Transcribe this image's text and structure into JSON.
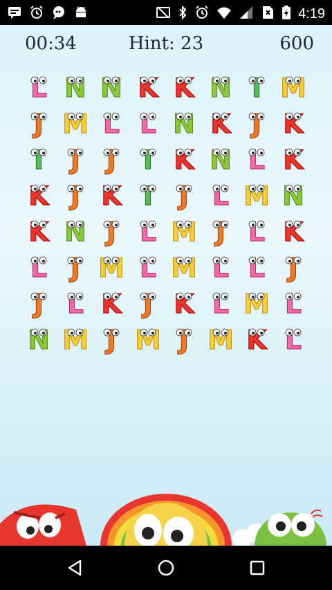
{
  "status_bar": {
    "time": "4:19",
    "left_icons": [
      "message-icon",
      "alarm-icon",
      "chat-icon",
      "android-icon"
    ],
    "right_icons": [
      "cast-off-icon",
      "bluetooth-icon",
      "alarm-icon",
      "wifi-icon",
      "signal-icon",
      "no-sim-icon",
      "battery-icon"
    ]
  },
  "hud": {
    "timer": "00:34",
    "hint": "Hint: 23",
    "score": "600"
  },
  "board": {
    "rows": [
      [
        "L",
        "N",
        "N",
        "K",
        "K",
        "N",
        "I",
        "M"
      ],
      [
        "J",
        "M",
        "L",
        "L",
        "N",
        "K",
        "J",
        "K"
      ],
      [
        "I",
        "J",
        "J",
        "I",
        "K",
        "N",
        "L",
        "K"
      ],
      [
        "K",
        "J",
        "K",
        "I",
        "J",
        "L",
        "M",
        "N"
      ],
      [
        "K",
        "N",
        "J",
        "L",
        "M",
        "J",
        "L",
        "K"
      ],
      [
        "L",
        "J",
        "M",
        "L",
        "M",
        "L",
        "L",
        "J"
      ],
      [
        "J",
        "L",
        "K",
        "J",
        "K",
        "L",
        "M",
        "L"
      ],
      [
        "N",
        "M",
        "J",
        "M",
        "J",
        "M",
        "K",
        "L"
      ]
    ],
    "letter_colors": {
      "L": "#f06aa8",
      "N": "#8cc63f",
      "K": "#e8352e",
      "I": "#5cb85c",
      "M": "#f7cd3c",
      "J": "#e87a2a"
    }
  },
  "navigation": {
    "back": "back-icon",
    "home": "home-icon",
    "recents": "recents-icon"
  }
}
